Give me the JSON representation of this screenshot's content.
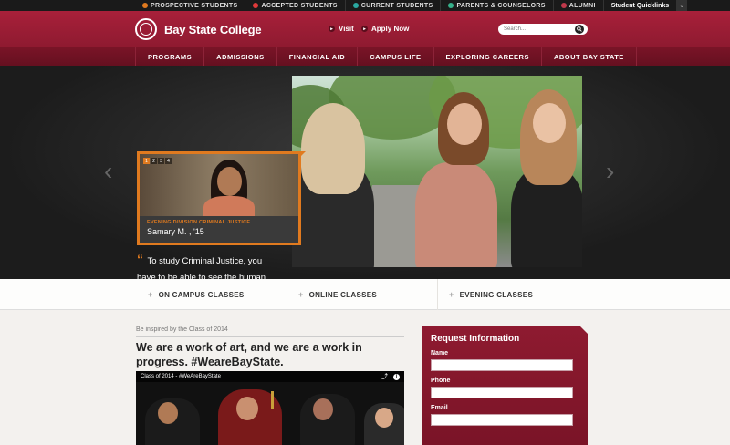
{
  "utility": {
    "items": [
      {
        "label": "Prospective Students",
        "color": "#e07a1f"
      },
      {
        "label": "Accepted Students",
        "color": "#e03a3a"
      },
      {
        "label": "Current Students",
        "color": "#2aa8a0"
      },
      {
        "label": "Parents & Counselors",
        "color": "#36b08a"
      },
      {
        "label": "Alumni",
        "color": "#c0394b"
      }
    ],
    "quicklinks": "Student Quicklinks",
    "chevron": "⌄"
  },
  "header": {
    "logo_text": "Bay State College",
    "visit_label": "Visit",
    "apply_label": "Apply Now",
    "search_placeholder": "Search...",
    "brand_color": "#9b1d35"
  },
  "nav": {
    "items": [
      "PROGRAMS",
      "ADMISSIONS",
      "FINANCIAL AID",
      "CAMPUS LIFE",
      "EXPLORING CAREERS",
      "ABOUT BAY STATE"
    ]
  },
  "hero": {
    "tabs": [
      "1",
      "2",
      "3",
      "4"
    ],
    "active_tab": "1",
    "feature_tag": "Evening Division Criminal Justice",
    "feature_name": "Samary M. , '15",
    "quote_mark": "“",
    "quote": "To study Criminal Justice, you have to be able to see the human side in everyone, even criminals.",
    "prev_arrow": "‹",
    "next_arrow": "›",
    "accent_color": "#e07a1f"
  },
  "classes": {
    "items": [
      "ON CAMPUS CLASSES",
      "ONLINE CLASSES",
      "EVENING CLASSES"
    ],
    "plus": "+"
  },
  "content": {
    "inspired": "Be inspired by the Class of 2014",
    "headline": "We are a work of art, and we are a work in progress. #WeareBayState.",
    "video_title": "Class of 2014 - #WeAreBayState",
    "share_icon": "⤴",
    "info_icon": "i"
  },
  "request": {
    "title": "Request Information",
    "labels": [
      "Name",
      "Phone",
      "Email"
    ]
  }
}
